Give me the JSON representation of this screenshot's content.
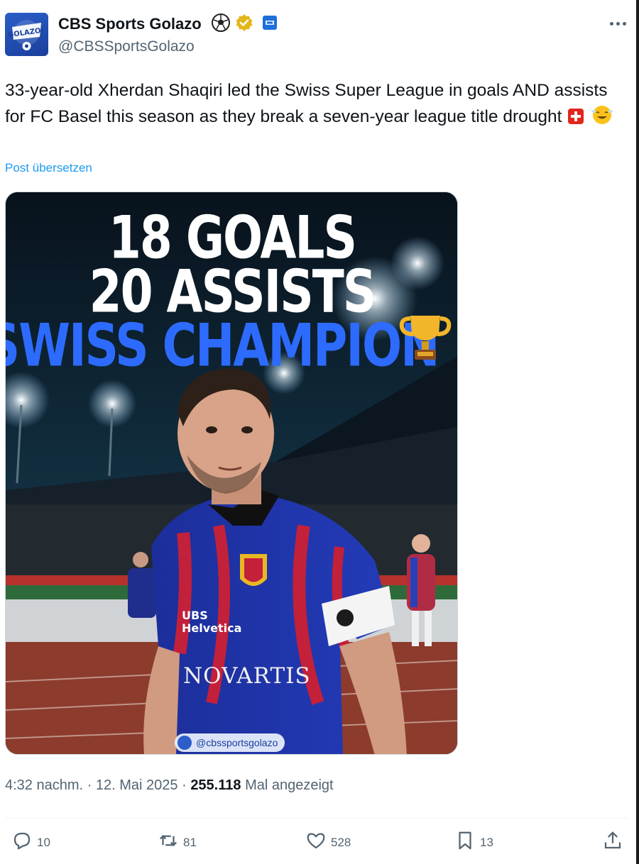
{
  "author": {
    "display_name": "CBS Sports Golazo",
    "handle": "@CBSSportsGolazo",
    "avatar_text": "GOLAZO!"
  },
  "tweet": {
    "text": "33-year-old Xherdan Shaqiri led the Swiss Super League in goals AND assists for FC Basel this season as they break a seven-year league title drought",
    "translate_label": "Post übersetzen"
  },
  "media": {
    "headline_line1": "18 GOALS",
    "headline_line2": "20 ASSISTS",
    "headline_line3": "SWISS CHAMPION",
    "watermark": "@cbssportsgolazo",
    "sponsor1": "UBS Helvetica",
    "sponsor2": "NOVARTIS"
  },
  "meta": {
    "time": "4:32 nachm.",
    "separator": "·",
    "date": "12. Mai 2025",
    "views_count": "255.118",
    "views_label": "Mal angezeigt"
  },
  "actions": {
    "replies": "10",
    "reposts": "81",
    "likes": "528",
    "bookmarks": "13"
  },
  "colors": {
    "accent_link": "#1d9bf0",
    "secondary_text": "#536471",
    "headline_blue": "#2d6bff",
    "verified_gold": "#e2b719"
  },
  "icons": [
    "soccer-ball-icon",
    "verified-badge-icon",
    "affiliate-badge-icon",
    "more-icon",
    "swiss-flag-icon",
    "smiling-emoji-icon",
    "trophy-icon",
    "reply-icon",
    "repost-icon",
    "like-icon",
    "bookmark-icon",
    "share-icon"
  ]
}
